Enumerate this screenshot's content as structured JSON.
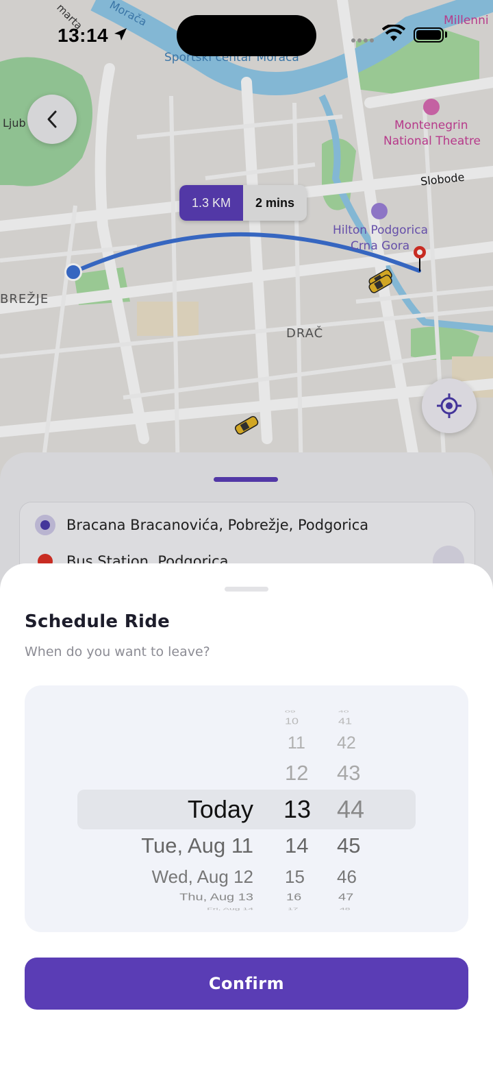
{
  "status_bar": {
    "time": "13:14"
  },
  "map": {
    "labels": {
      "top_left_street": "martą",
      "river": "Morača",
      "sports_center": "Sportski centar Morača",
      "left_edge": "Ljub",
      "millennium": "Millenni",
      "theatre_line1": "Montenegrin",
      "theatre_line2": "National Theatre",
      "slobode": "Slobode",
      "hilton_line1": "Hilton Podgorica",
      "hilton_line2": "Crna Gora",
      "brezje": "BREŽJE",
      "drac": "DRAČ"
    },
    "route": {
      "distance": "1.3 KM",
      "duration": "2 mins"
    }
  },
  "trip": {
    "origin": "Bracana Bracanovića, Pobrežje, Podgorica",
    "destination": "Bus Station, Podgorica"
  },
  "schedule": {
    "title": "Schedule Ride",
    "subtitle": "When do you want to leave?",
    "days": {
      "selected": "Today",
      "next1": "Tue, Aug 11",
      "next2": "Wed, Aug 12",
      "next3": "Thu, Aug 13",
      "next4": "Fri, Aug 14"
    },
    "hours": {
      "prev4": "09",
      "prev3": "10",
      "prev2": "11",
      "prev1": "12",
      "selected": "13",
      "next1": "14",
      "next2": "15",
      "next3": "16",
      "next4": "17"
    },
    "minutes": {
      "prev4": "40",
      "prev3": "41",
      "prev2": "42",
      "prev1": "43",
      "selected": "44",
      "next1": "45",
      "next2": "46",
      "next3": "47",
      "next4": "48"
    },
    "confirm_label": "Confirm"
  },
  "colors": {
    "accent": "#5a3db5",
    "route": "#3b6fd1",
    "pin": "#d93025"
  }
}
